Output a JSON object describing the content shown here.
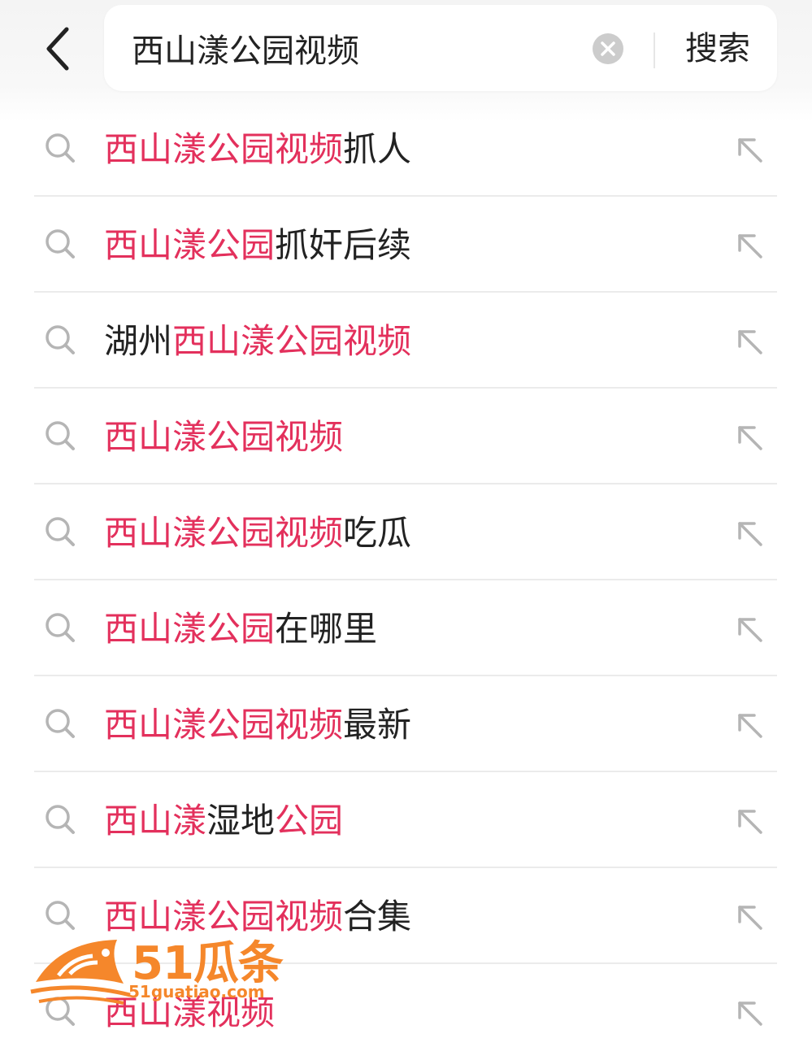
{
  "header": {
    "back_icon": "chevron-left-icon",
    "search_query": "西山漾公园视频",
    "clear_icon": "clear-circle-icon",
    "search_label": "搜索"
  },
  "suggestions": [
    {
      "segments": [
        {
          "text": "西山漾公园视频",
          "highlight": true
        },
        {
          "text": "抓人",
          "highlight": false
        }
      ]
    },
    {
      "segments": [
        {
          "text": "西山漾公园",
          "highlight": true
        },
        {
          "text": "抓奸后续",
          "highlight": false
        }
      ]
    },
    {
      "segments": [
        {
          "text": "湖州",
          "highlight": false
        },
        {
          "text": "西山漾公园视频",
          "highlight": true
        }
      ]
    },
    {
      "segments": [
        {
          "text": "西山漾公园视频",
          "highlight": true
        }
      ]
    },
    {
      "segments": [
        {
          "text": "西山漾公园视频",
          "highlight": true
        },
        {
          "text": "吃瓜",
          "highlight": false
        }
      ]
    },
    {
      "segments": [
        {
          "text": "西山漾公园",
          "highlight": true
        },
        {
          "text": "在哪里",
          "highlight": false
        }
      ]
    },
    {
      "segments": [
        {
          "text": "西山漾公园视频",
          "highlight": true
        },
        {
          "text": "最新",
          "highlight": false
        }
      ]
    },
    {
      "segments": [
        {
          "text": "西山漾",
          "highlight": true
        },
        {
          "text": "湿地",
          "highlight": false
        },
        {
          "text": "公园",
          "highlight": true
        }
      ]
    },
    {
      "segments": [
        {
          "text": "西山漾公园视频",
          "highlight": true
        },
        {
          "text": "合集",
          "highlight": false
        }
      ]
    },
    {
      "segments": [
        {
          "text": "西山漾视频",
          "highlight": true
        }
      ]
    }
  ],
  "watermark": {
    "number": "51瓜条",
    "url": "51guatiao.com"
  },
  "colors": {
    "highlight": "#e3305c",
    "text": "#222222",
    "icon_gray": "#b5b5b5",
    "watermark": "#f5872b"
  }
}
